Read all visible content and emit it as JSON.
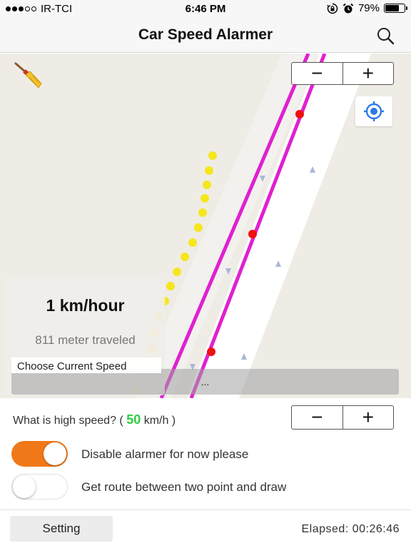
{
  "status_bar": {
    "carrier": "IR-TCI",
    "time": "6:46 PM",
    "battery_percent": "79%",
    "battery_level": 0.79,
    "signal_bars_filled": 3,
    "signal_bars_total": 5
  },
  "nav": {
    "title": "Car Speed Alarmer",
    "search_icon": "search-icon"
  },
  "map": {
    "clear_icon": "broom-icon",
    "zoom_out_label": "−",
    "zoom_in_label": "+",
    "locate_icon": "crosshair-location-icon",
    "route_color": "#e020d0",
    "trail_color": "#f5e61e",
    "marker_color": "#ee1111"
  },
  "speed_panel": {
    "current_speed": "1 km/hour",
    "distance": "811 meter traveled",
    "choose_label": "Choose Current Speed",
    "choose_value": "..."
  },
  "settings": {
    "high_speed_prefix": "What is high speed? (",
    "high_speed_value": "50",
    "high_speed_suffix": "km/h )",
    "decrease_label": "−",
    "increase_label": "+",
    "toggles": [
      {
        "label": "Disable alarmer for now please",
        "on": true
      },
      {
        "label": "Get route between two point and draw",
        "on": false
      }
    ],
    "accent_color": "#f07818"
  },
  "footer": {
    "setting_label": "Setting",
    "elapsed": "Elapsed: 00:26:46"
  }
}
